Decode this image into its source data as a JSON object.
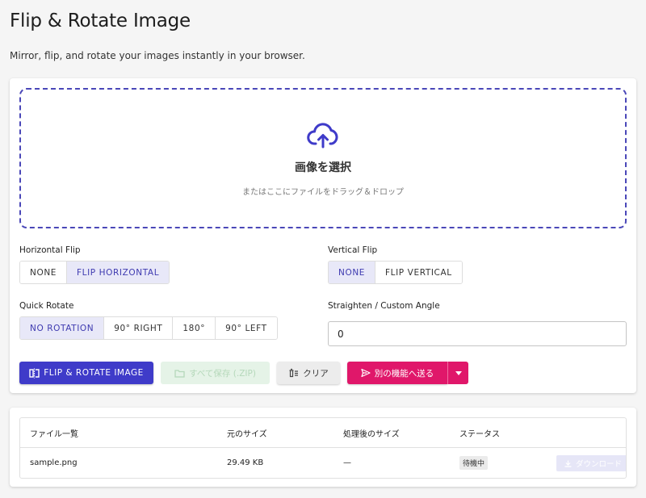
{
  "header": {
    "title": "Flip & Rotate Image",
    "subtitle": "Mirror, flip, and rotate your images instantly in your browser."
  },
  "dropzone": {
    "icon": "cloud-upload-icon",
    "title": "画像を選択",
    "hint": "またはここにファイルをドラッグ＆ドロップ"
  },
  "horizontal_flip": {
    "label": "Horizontal Flip",
    "options": [
      "NONE",
      "FLIP HORIZONTAL"
    ],
    "selected": "FLIP HORIZONTAL"
  },
  "vertical_flip": {
    "label": "Vertical Flip",
    "options": [
      "NONE",
      "FLIP VERTICAL"
    ],
    "selected": "NONE"
  },
  "quick_rotate": {
    "label": "Quick Rotate",
    "options": [
      "NO ROTATION",
      "90° RIGHT",
      "180°",
      "90° LEFT"
    ],
    "selected": "NO ROTATION"
  },
  "custom_angle": {
    "label": "Straighten / Custom Angle",
    "value": "0"
  },
  "actions": {
    "run_label": "FLIP & ROTATE IMAGE",
    "save_all_label": "すべて保存 (.ZIP)",
    "clear_label": "クリア",
    "send_label": "別の機能へ送る"
  },
  "file_table": {
    "headers": [
      "ファイル一覧",
      "元のサイズ",
      "処理後のサイズ",
      "ステータス"
    ],
    "rows": [
      {
        "name": "sample.png",
        "original_size": "29.49 KB",
        "processed_size": "—",
        "status": "待機中",
        "download_label": "ダウンロード"
      }
    ]
  },
  "colors": {
    "primary": "#3f3bc9",
    "accent": "#e0176a",
    "selected_bg": "#e8e8f8",
    "disabled_green": "#e5f3e7"
  }
}
